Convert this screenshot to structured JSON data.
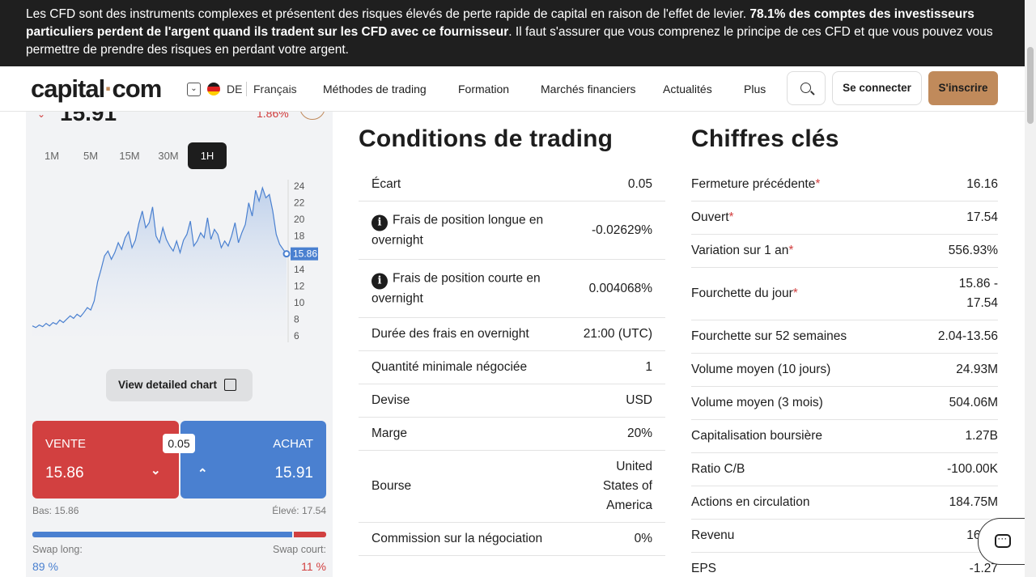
{
  "risk_banner": {
    "text_plain": "Les CFD sont des instruments complexes et présentent des risques élevés de perte rapide de capital en raison de l'effet de levier. ",
    "text_bold": "78.1% des comptes des investisseurs particuliers perdent de l'argent quand ils tradent sur les CFD avec ce fournisseur",
    "text_tail": ". Il faut s'assurer que vous comprenez le principe de ces CFD et que vous pouvez vous permettre de prendre des risques en perdant votre argent."
  },
  "header": {
    "logo_main": "capital",
    "logo_dot": "·",
    "logo_tld": "com",
    "lang_code": "DE",
    "lang_name": "Français",
    "nav": [
      "Méthodes de trading",
      "Formation",
      "Marchés financiers",
      "Actualités",
      "Plus"
    ],
    "login_label": "Se connecter",
    "signup_label": "S'inscrire",
    "icons": {
      "search": "search-icon",
      "language": "chevron-down-icon",
      "flag": "germany-flag-icon"
    }
  },
  "instrument": {
    "price": "15.91",
    "change_pct": "1.86%",
    "timeframes": [
      "1M",
      "5M",
      "15M",
      "30M",
      "1H"
    ],
    "active_timeframe": "1H",
    "current_price_label": "15.86",
    "detail_chart_label": "View detailed chart",
    "sell_label": "VENTE",
    "sell_price": "15.86",
    "buy_label": "ACHAT",
    "buy_price": "15.91",
    "spread": "0.05",
    "low": "Bas: 15.86",
    "high": "Élevé: 17.54",
    "swap_long_label": "Swap long:",
    "swap_long_value": "89 %",
    "swap_short_label": "Swap court:",
    "swap_short_value": "11 %",
    "swap_long_fraction": 0.89,
    "colors": {
      "sell": "#d24040",
      "buy": "#4a80d0",
      "accent": "#c08a5b"
    }
  },
  "chart_data": {
    "type": "area",
    "y_ticks": [
      "24",
      "22",
      "20",
      "18",
      "16",
      "14",
      "12",
      "10",
      "8",
      "6"
    ],
    "ylim": [
      6,
      24
    ],
    "values": [
      7.2,
      7.0,
      7.3,
      7.1,
      7.5,
      7.2,
      7.6,
      7.4,
      7.9,
      7.6,
      8.0,
      8.4,
      8.1,
      8.6,
      8.3,
      8.8,
      9.4,
      9.1,
      10.2,
      12.5,
      14.0,
      15.6,
      16.2,
      15.2,
      16.0,
      17.2,
      16.4,
      17.8,
      18.5,
      16.6,
      17.5,
      19.5,
      21.0,
      19.0,
      19.6,
      21.5,
      18.0,
      17.2,
      19.0,
      17.6,
      16.8,
      16.2,
      17.4,
      16.0,
      17.5,
      18.2,
      19.8,
      16.8,
      17.4,
      18.4,
      17.8,
      20.2,
      17.6,
      18.8,
      18.2,
      16.6,
      17.4,
      16.8,
      18.0,
      19.6,
      17.2,
      18.4,
      19.4,
      22.0,
      20.4,
      23.5,
      22.2,
      23.8,
      22.6,
      23.0,
      21.0,
      18.2,
      17.0,
      16.4,
      15.86
    ]
  },
  "trading_conditions": {
    "title": "Conditions de trading",
    "rows": [
      {
        "label": "Écart",
        "value": "0.05",
        "info": false
      },
      {
        "label": "Frais de position longue en overnight",
        "value": "-0.02629%",
        "info": true
      },
      {
        "label": "Frais de position courte en overnight",
        "value": "0.004068%",
        "info": true
      },
      {
        "label": "Durée des frais en overnight",
        "value": "21:00 (UTC)",
        "info": false
      },
      {
        "label": "Quantité minimale négociée",
        "value": "1",
        "info": false
      },
      {
        "label": "Devise",
        "value": "USD",
        "info": false
      },
      {
        "label": "Marge",
        "value": "20%",
        "info": false
      },
      {
        "label": "Bourse",
        "value": "United States of America",
        "info": false
      },
      {
        "label": "Commission sur la négociation",
        "value": "0%",
        "info": false
      }
    ]
  },
  "key_figures": {
    "title": "Chiffres clés",
    "rows": [
      {
        "label": "Fermeture précédente",
        "value": "16.16",
        "star": true
      },
      {
        "label": "Ouvert",
        "value": "17.54",
        "star": true
      },
      {
        "label": "Variation sur 1 an",
        "value": "556.93%",
        "star": true
      },
      {
        "label": "Fourchette du jour",
        "value": "15.86 - 17.54",
        "star": true
      },
      {
        "label": "Fourchette sur 52 semaines",
        "value": "2.04-13.56",
        "star": false
      },
      {
        "label": "Volume moyen (10 jours)",
        "value": "24.93M",
        "star": false
      },
      {
        "label": "Volume moyen (3 mois)",
        "value": "504.06M",
        "star": false
      },
      {
        "label": "Capitalisation boursière",
        "value": "1.27B",
        "star": false
      },
      {
        "label": "Ratio C/B",
        "value": "-100.00K",
        "star": false
      },
      {
        "label": "Actions en circulation",
        "value": "184.75M",
        "star": false
      },
      {
        "label": "Revenu",
        "value": "168.4",
        "star": false
      },
      {
        "label": "EPS",
        "value": "-1.27",
        "star": false
      }
    ]
  }
}
